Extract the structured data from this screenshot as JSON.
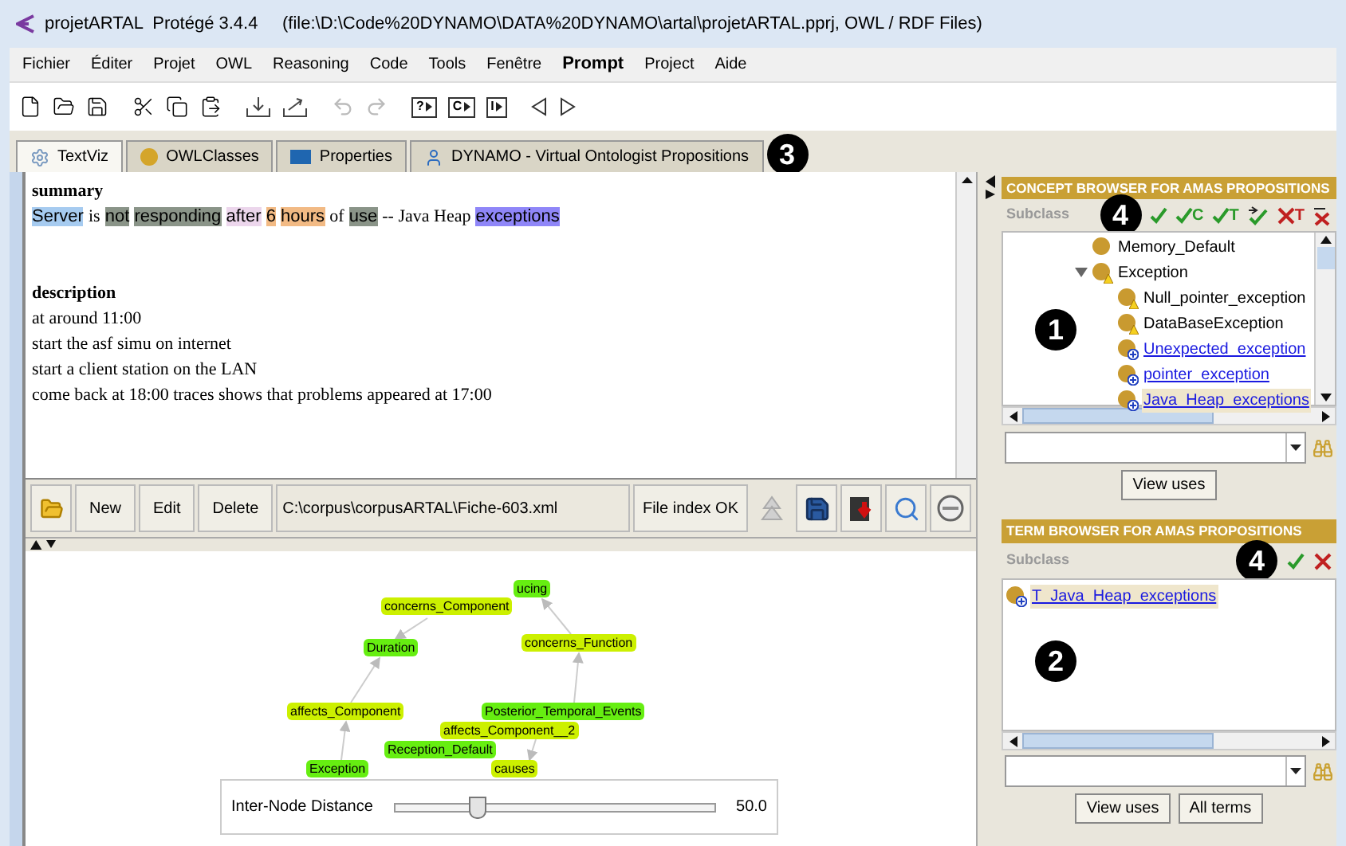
{
  "window": {
    "title": "projetARTAL  Protégé 3.4.4     (file:\\D:\\Code%20DYNAMO\\DATA%20DYNAMO\\artal\\projetARTAL.pprj, OWL / RDF Files)"
  },
  "menu": [
    {
      "label": "Fichier",
      "emphasized": false
    },
    {
      "label": "Éditer",
      "emphasized": false
    },
    {
      "label": "Projet",
      "emphasized": false
    },
    {
      "label": "OWL",
      "emphasized": false
    },
    {
      "label": "Reasoning",
      "emphasized": false
    },
    {
      "label": "Code",
      "emphasized": false
    },
    {
      "label": "Tools",
      "emphasized": false
    },
    {
      "label": "Fenêtre",
      "emphasized": false
    },
    {
      "label": "Prompt",
      "emphasized": true
    },
    {
      "label": "Project",
      "emphasized": false
    },
    {
      "label": "Aide",
      "emphasized": false
    }
  ],
  "toolbar": {
    "boxed_buttons": [
      "?",
      "C",
      "I"
    ]
  },
  "tabs": {
    "items": [
      {
        "label": "TextViz",
        "kind": "gear",
        "selected": true
      },
      {
        "label": "OWLClasses",
        "kind": "class",
        "selected": false
      },
      {
        "label": "Properties",
        "kind": "property",
        "selected": false
      },
      {
        "label": "DYNAMO - Virtual Ontologist Propositions",
        "kind": "person",
        "selected": false
      }
    ],
    "callout": "3"
  },
  "document": {
    "summary": {
      "heading": "summary",
      "tokens": [
        {
          "text": "Server",
          "color": "#a6cbf0"
        },
        {
          "text": "is"
        },
        {
          "text": "not",
          "color": "#8a9488"
        },
        {
          "text": "responding",
          "color": "#8a9488"
        },
        {
          "text": "after",
          "color": "#ecd6ec"
        },
        {
          "text": "6",
          "color": "#f2ba84"
        },
        {
          "text": "hours",
          "color": "#f2ba84"
        },
        {
          "text": "of"
        },
        {
          "text": "use",
          "color": "#8a9488"
        },
        {
          "text": "-- Java Heap"
        },
        {
          "text": "exceptions",
          "color": "#8f86f8"
        }
      ]
    },
    "description": {
      "heading": "description",
      "lines": [
        "at around 11:00",
        "start the asf simu on internet",
        "start a client station on the LAN",
        "come back at 18:00 traces shows that problems appeared at 17:00"
      ]
    }
  },
  "doc_toolbar": {
    "buttons": [
      "New",
      "Edit",
      "Delete"
    ],
    "path": "C:\\corpus\\corpusARTAL\\Fiche-603.xml",
    "index_button": "File index OK"
  },
  "graph": {
    "nodes": [
      {
        "label": "ucing",
        "color": "#66ee11"
      },
      {
        "label": "concerns_Component",
        "color": "#ccf000"
      },
      {
        "label": "Duration",
        "color": "#66ee11"
      },
      {
        "label": "concerns_Function",
        "color": "#ccf000"
      },
      {
        "label": "affects_Component",
        "color": "#ccf000"
      },
      {
        "label": "Posterior_Temporal_Events",
        "color": "#66ee11"
      },
      {
        "label": "affects_Component__2",
        "color": "#ccf000"
      },
      {
        "label": "Reception_Default",
        "color": "#66ee11"
      },
      {
        "label": "causes",
        "color": "#ccf000"
      },
      {
        "label": "Exception",
        "color": "#66ee11"
      }
    ],
    "slider": {
      "label": "Inter-Node Distance",
      "level": 0.25,
      "reading": "50.0"
    }
  },
  "concept_browser": {
    "title": "CONCEPT BROWSER FOR AMAS PROPOSITIONS",
    "subclass_label": "Subclass",
    "callout": "4",
    "tools": [
      {
        "kind": "accept"
      },
      {
        "kind": "accept",
        "letter": "C"
      },
      {
        "kind": "accept",
        "letter": "T"
      },
      {
        "kind": "accept-down"
      },
      {
        "kind": "reject",
        "letter": "T"
      },
      {
        "kind": "remove"
      }
    ],
    "tree": [
      {
        "label": "Memory_Default",
        "kind": "plain",
        "selected": false
      },
      {
        "label": "Exception",
        "kind": "warning",
        "selected": false,
        "expanded": true,
        "children": [
          {
            "label": "Null_pointer_exception",
            "kind": "warning",
            "selected": false
          },
          {
            "label": "DataBaseException",
            "kind": "warning",
            "selected": false
          },
          {
            "label": "Unexpected_exception",
            "kind": "new",
            "selected": false
          },
          {
            "label": "pointer_exception",
            "kind": "new",
            "selected": false
          },
          {
            "label": "Java_Heap_exceptions",
            "kind": "new",
            "selected": true
          }
        ]
      }
    ],
    "tree_callout": "1",
    "buttons": [
      "View uses"
    ]
  },
  "term_browser": {
    "title": "TERM BROWSER FOR AMAS PROPOSITIONS",
    "subclass_label": "Subclass",
    "callout": "4",
    "tools": [
      {
        "kind": "accept"
      },
      {
        "kind": "reject"
      }
    ],
    "items": [
      {
        "label": "T_Java_Heap_exceptions",
        "kind": "new",
        "selected": true
      }
    ],
    "list_callout": "2",
    "buttons": [
      "View uses",
      "All terms"
    ]
  }
}
